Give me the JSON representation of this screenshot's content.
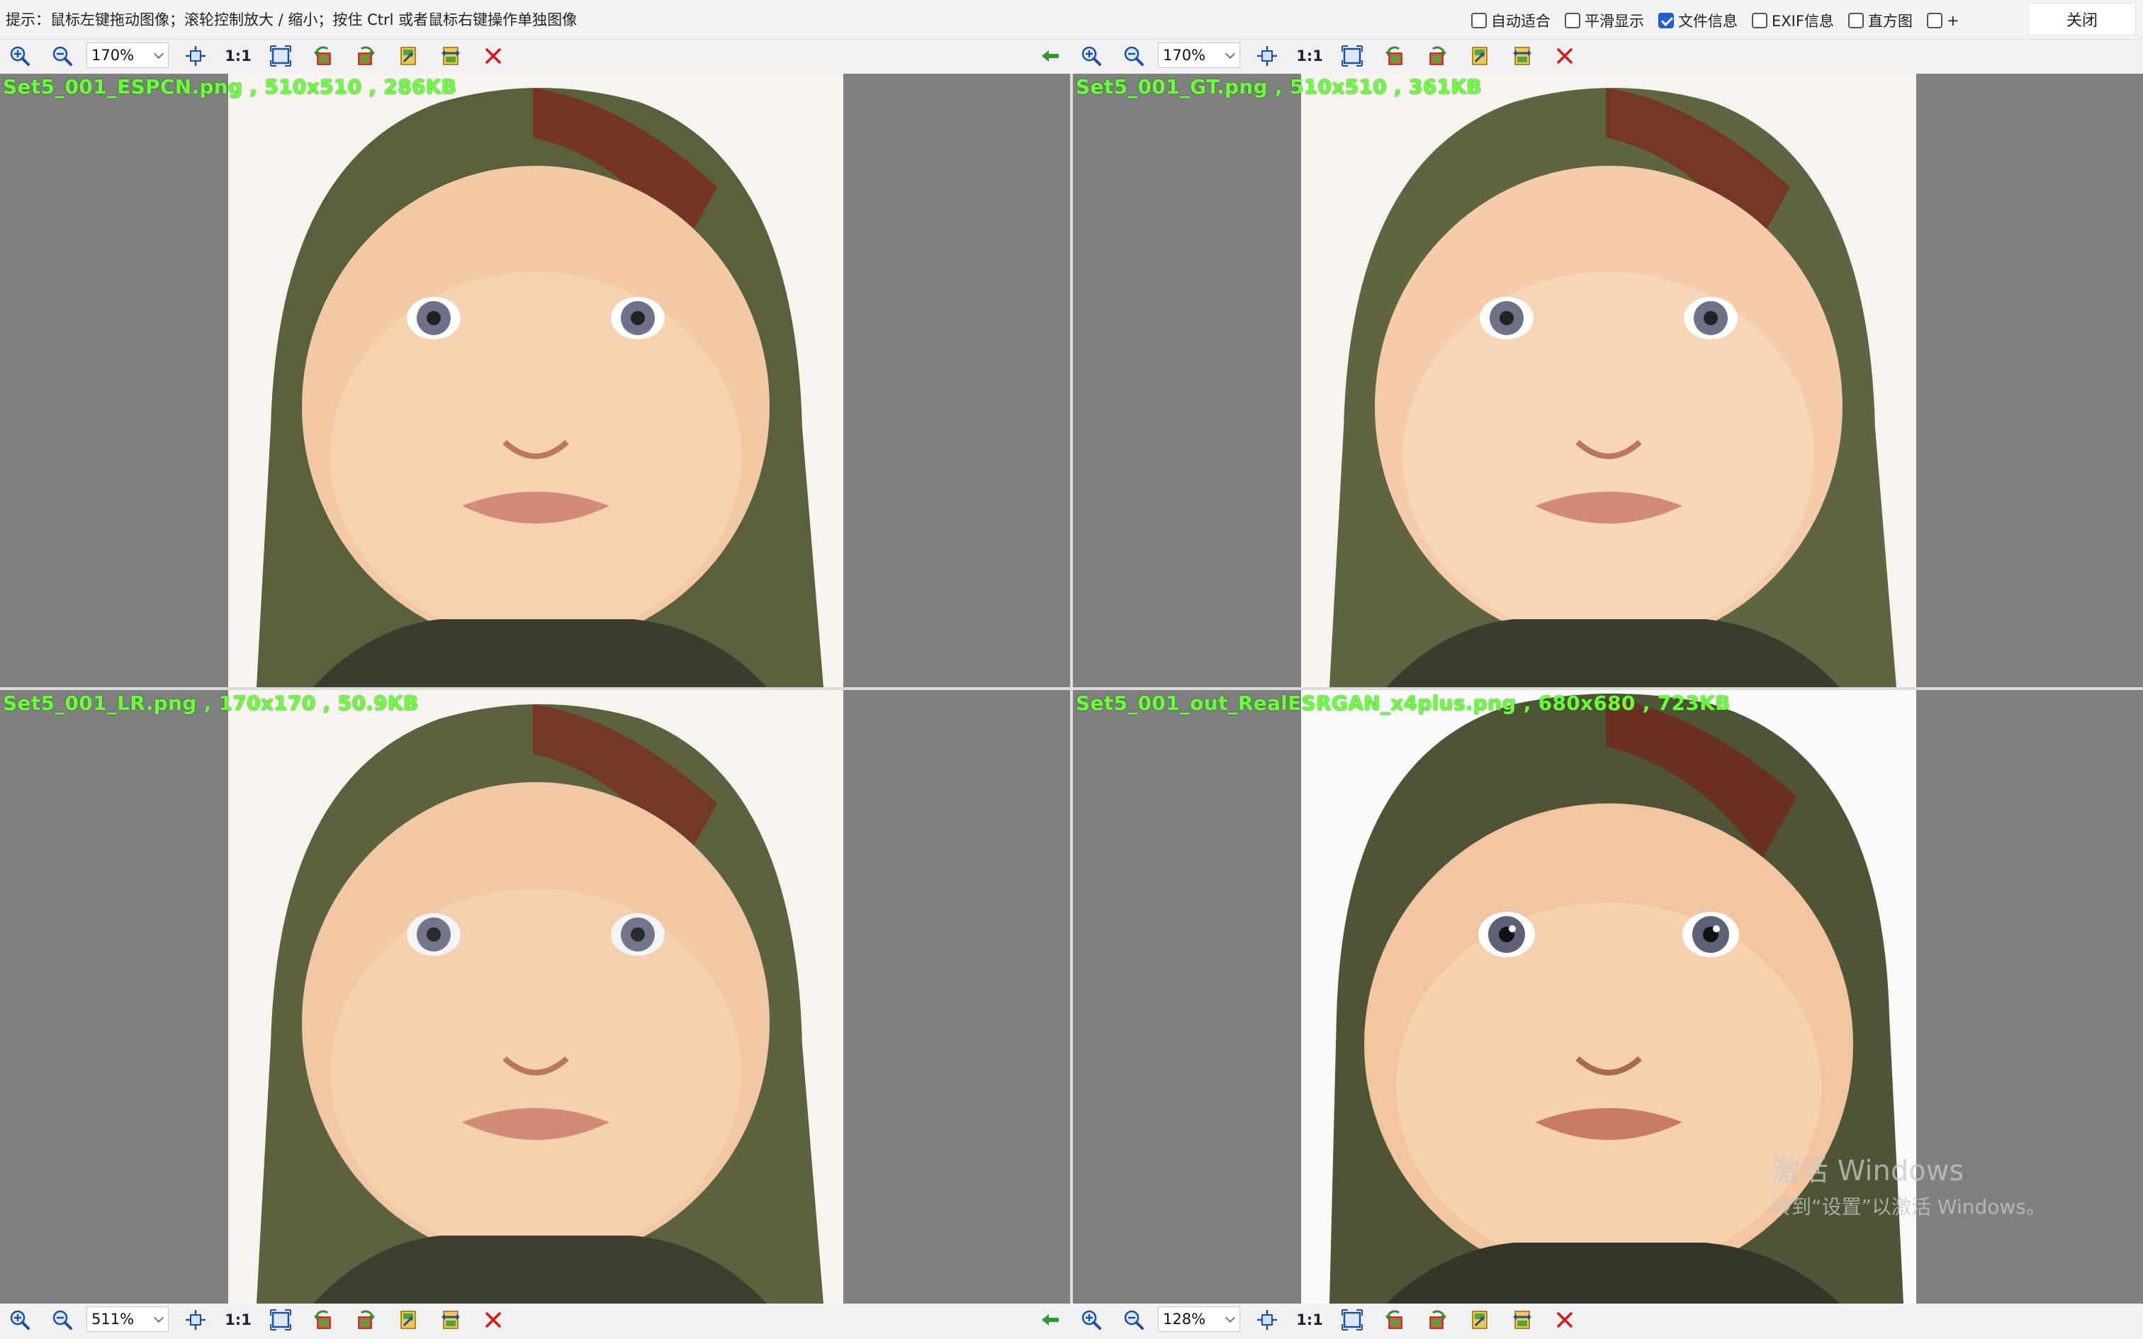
{
  "topbar": {
    "hint": "提示：鼠标左键拖动图像；滚轮控制放大 / 缩小；按住 Ctrl 或者鼠标右键操作单独图像",
    "options": [
      {
        "label": "自动适合",
        "checked": false
      },
      {
        "label": "平滑显示",
        "checked": false
      },
      {
        "label": "文件信息",
        "checked": true
      },
      {
        "label": "EXIF信息",
        "checked": false
      },
      {
        "label": "直方图",
        "checked": false
      },
      {
        "label": "+",
        "checked": false
      }
    ],
    "close_label": "关闭"
  },
  "toolbars": {
    "top_left": {
      "zoom": "170%",
      "one_one": "1:1"
    },
    "top_right": {
      "zoom": "170%",
      "one_one": "1:1"
    },
    "bottom_left": {
      "zoom": "511%",
      "one_one": "1:1"
    },
    "bottom_right": {
      "zoom": "128%",
      "one_one": "1:1"
    }
  },
  "panes": [
    {
      "file_info": "Set5_001_ESPCN.png , 510x510 , 286KB"
    },
    {
      "file_info": "Set5_001_GT.png , 510x510 , 361KB"
    },
    {
      "file_info": "Set5_001_LR.png , 170x170 , 50.9KB"
    },
    {
      "file_info": "Set5_001_out_RealESRGAN_x4plus.png , 680x680 , 723KB"
    }
  ],
  "watermark": {
    "line1": "激活 Windows",
    "line2": "转到“设置”以激活 Windows。"
  },
  "colors": {
    "pane_bg": "#808080",
    "file_info_text": "#6bff3a",
    "checkbox_checked": "#1f5fcf",
    "close_icon": "#d11a1a",
    "back_arrow": "#2e9a2e"
  }
}
